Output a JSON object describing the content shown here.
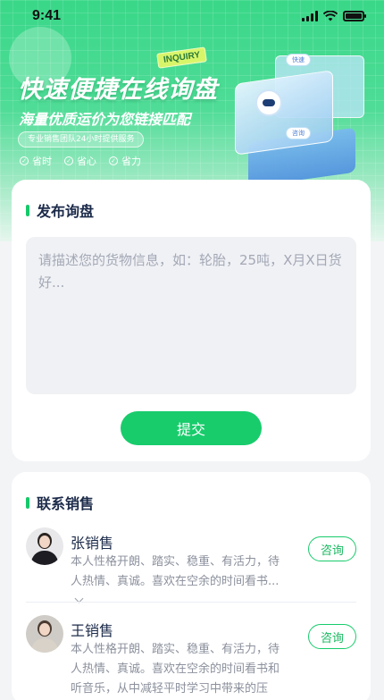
{
  "status_bar": {
    "time": "9:41"
  },
  "hero": {
    "tag": "INQUIRY",
    "headline": "快速便捷在线询盘",
    "subline": "海量优质运价为您链接匹配",
    "badge": "专业销售团队24小时提供服务",
    "benefits": [
      "省时",
      "省心",
      "省力"
    ],
    "bubbles": [
      "快速",
      "咨询"
    ]
  },
  "post_inquiry": {
    "title": "发布询盘",
    "placeholder": "请描述您的货物信息，如：轮胎，25吨，X月X日货好...",
    "submit_label": "提交"
  },
  "contact_sales": {
    "title": "联系销售",
    "consult_label": "咨询",
    "people": [
      {
        "name": "张销售",
        "desc": "本人性格开朗、踏实、稳重、有活力，待人热情、真诚。喜欢在空余的时间看书..."
      },
      {
        "name": "王销售",
        "desc": "本人性格开朗、踏实、稳重、有活力，待人热情、真诚。喜欢在空余的时间看书和听音乐，从中减轻平时学习中带来的压"
      }
    ]
  },
  "colors": {
    "accent": "#18cc6c",
    "title": "#1c2b4a",
    "muted": "#8b909c"
  }
}
